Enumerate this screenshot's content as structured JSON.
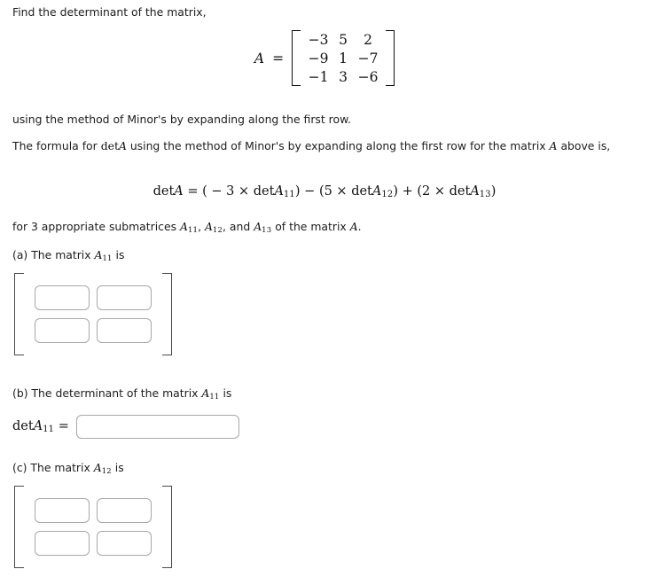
{
  "problem": {
    "prompt": "Find the determinant of the matrix,",
    "method_note": "using the method of Minor's by expanding along the first row.",
    "formula_intro_1": "The formula for ",
    "formula_intro_det": "det",
    "formula_intro_var": "A",
    "formula_intro_2": " using the method of Minor's by expanding along the first row for the matrix ",
    "formula_intro_var2": "A",
    "formula_intro_3": " above is,",
    "submatrix_note_1": "for 3 appropriate submatrices ",
    "submatrix_note_2": ", and ",
    "submatrix_note_3": " of the matrix ",
    "submatrix_note_end": "."
  },
  "matrix_A": {
    "name": "A",
    "equals": "=",
    "rows": [
      [
        "−3",
        "5",
        "2"
      ],
      [
        "−9",
        "1",
        "−7"
      ],
      [
        "−1",
        "3",
        "−6"
      ]
    ]
  },
  "formula": {
    "lhs_det": "det",
    "lhs_var": "A",
    "equals": "=",
    "term1_open": "( − 3 × ",
    "term1_det": "det",
    "term1_var": "A",
    "term1_sub": "11",
    "term1_close": ")",
    "minus": " − ",
    "term2_open": "(5 × ",
    "term2_det": "det",
    "term2_var": "A",
    "term2_sub": "12",
    "term2_close": ")",
    "plus": " + ",
    "term3_open": "(2 × ",
    "term3_det": "det",
    "term3_var": "A",
    "term3_sub": "13",
    "term3_close": ")",
    "full_text": "detA = ( − 3 × detA11) − (5 × detA12) + (2 × detA13)"
  },
  "subscripts": {
    "s11": "11",
    "s12": "12",
    "s13": "13"
  },
  "parts": {
    "a": {
      "tag": "(a)",
      "text_before": " The matrix ",
      "var": "A",
      "sub": "11",
      "text_after": " is",
      "inputs": [
        {
          "name": "a11-r1c1",
          "value": "",
          "placeholder": ""
        },
        {
          "name": "a11-r1c2",
          "value": "",
          "placeholder": ""
        },
        {
          "name": "a11-r2c1",
          "value": "",
          "placeholder": ""
        },
        {
          "name": "a11-r2c2",
          "value": "",
          "placeholder": ""
        }
      ]
    },
    "b": {
      "tag": "(b)",
      "text_before": " The determinant of the matrix ",
      "var": "A",
      "sub": "11",
      "text_after": " is",
      "det_label_op": "det",
      "det_label_var": "A",
      "det_label_sub": "11",
      "det_equals": "=",
      "input": {
        "name": "det-a11",
        "value": "",
        "placeholder": ""
      }
    },
    "c": {
      "tag": "(c)",
      "text_before": " The matrix ",
      "var": "A",
      "sub": "12",
      "text_after": " is",
      "inputs": [
        {
          "name": "a12-r1c1",
          "value": "",
          "placeholder": ""
        },
        {
          "name": "a12-r1c2",
          "value": "",
          "placeholder": ""
        },
        {
          "name": "a12-r2c1",
          "value": "",
          "placeholder": ""
        },
        {
          "name": "a12-r2c2",
          "value": "",
          "placeholder": ""
        }
      ]
    }
  },
  "colors": {
    "text": "#1c1c1c",
    "math": "#111111",
    "input_border": "#a8a8a8",
    "bracket": "#4a4a4a",
    "background": "#ffffff"
  }
}
